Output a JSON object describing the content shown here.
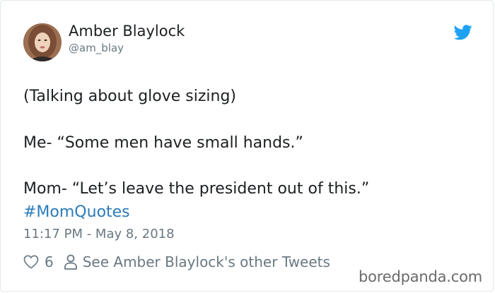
{
  "author": {
    "name": "Amber Blaylock",
    "handle": "@am_blay"
  },
  "tweet": {
    "line1": "(Talking about glove sizing)",
    "line2": "Me- “Some men have small hands.”",
    "line3": "Mom- “Let’s leave the president out of this.”",
    "hashtag": "#MomQuotes",
    "timestamp": "11:17 PM - May 8, 2018"
  },
  "actions": {
    "like_count": "6",
    "other_tweets_label": "See Amber Blaylock's other Tweets"
  },
  "watermark": "boredpanda.com",
  "icons": {
    "brand": "twitter-bird-icon",
    "like": "heart-icon",
    "profile": "person-icon"
  },
  "colors": {
    "twitter_blue": "#1da1f2",
    "link_blue": "#2b7bb9",
    "muted_text": "#697882",
    "body_text": "#1c2022"
  }
}
